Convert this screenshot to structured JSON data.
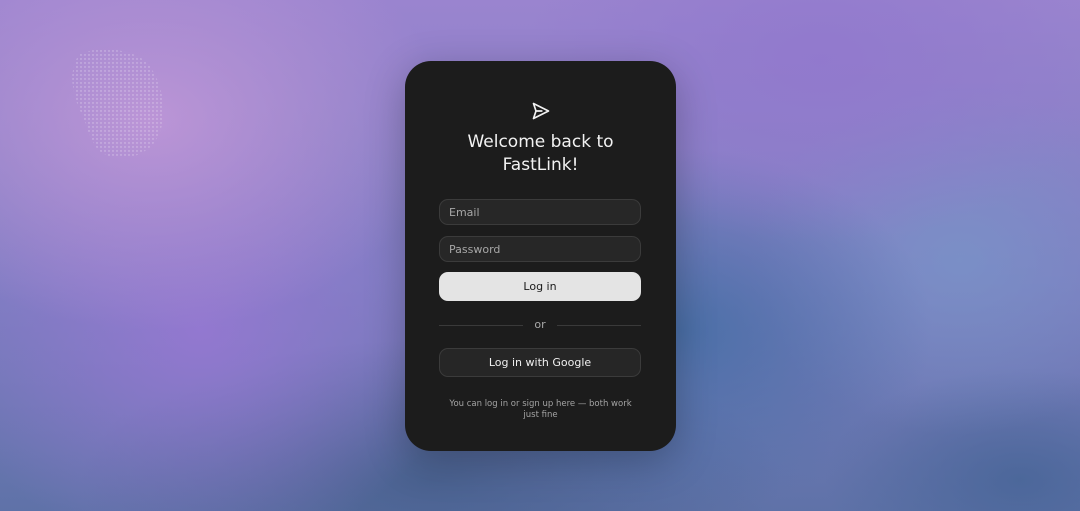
{
  "login": {
    "title": "Welcome back to\nFastLink!",
    "email_placeholder": "Email",
    "password_placeholder": "Password",
    "login_label": "Log in",
    "divider_label": "or",
    "google_label": "Log in with Google",
    "footnote": "You can log in or sign up here — both work just fine",
    "logo_icon": "paper-plane-icon"
  },
  "colors": {
    "card": "#1c1c1c",
    "primary_button": "#e4e4e4",
    "background_purple": "#9a84cf",
    "background_blue": "#5f72a8"
  }
}
